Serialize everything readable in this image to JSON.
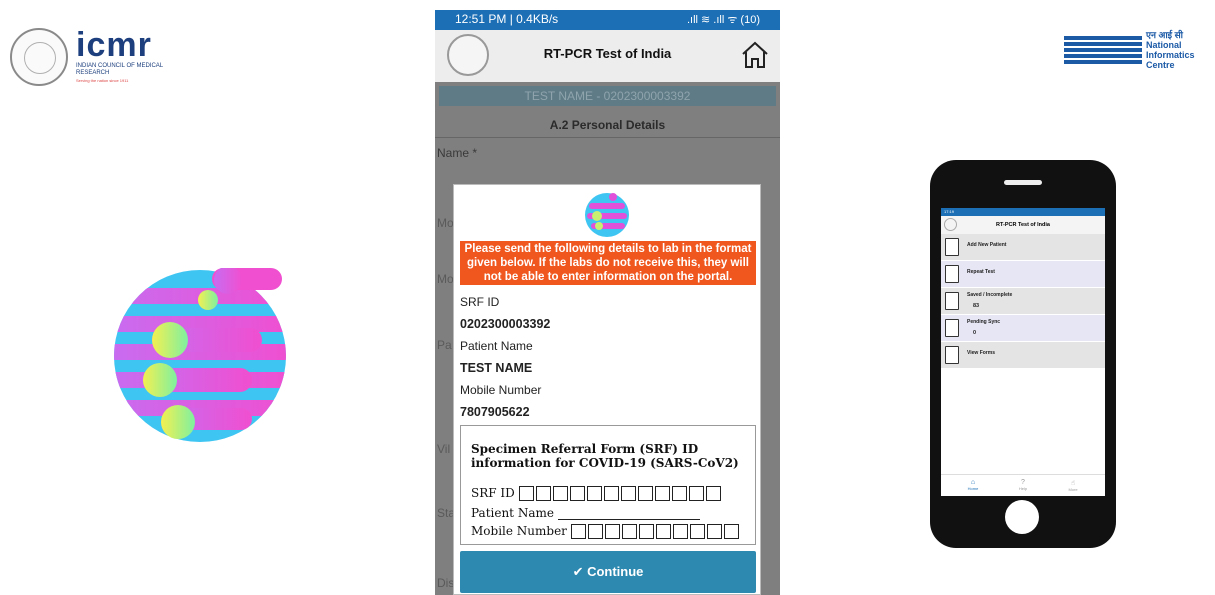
{
  "icmr": {
    "wordmark": "icmr",
    "subtitle": "INDIAN COUNCIL OF MEDICAL RESEARCH",
    "tagline": "Serving the nation since 1911"
  },
  "nic": {
    "hindi": "एन आई सी",
    "line1": "National",
    "line2": "Informatics",
    "line3": "Centre"
  },
  "phone": {
    "status_time": "12:51 PM | 0.4KB/s",
    "status_right": ".ıll ≋ .ıll ᯤ (10)",
    "app_title": "RT-PCR Test of India",
    "test_name_bar": "TEST NAME - 0202300003392",
    "section_title": "A.2 Personal Details",
    "bg_name_label": "Name *",
    "bg_ghost_1": "Mo",
    "bg_ghost_2": "Mo",
    "bg_ghost_3": "Pa",
    "bg_ghost_4": "Vil",
    "bg_ghost_5": "Sta",
    "bg_ghost_6": "Dis"
  },
  "modal": {
    "warning": "Please send the following details to lab in the format given below. If the labs do not receive this, they will not be able to enter information on the portal.",
    "srf_label": "SRF ID",
    "srf_value": "0202300003392",
    "patient_label": "Patient Name",
    "patient_value": "TEST NAME",
    "mobile_label": "Mobile Number",
    "mobile_value": "7807905622",
    "form_title": "Specimen Referral Form (SRF) ID information for COVID-19 (SARS-CoV2)",
    "form_srf": "SRF ID",
    "form_patient": "Patient Name",
    "form_mobile": "Mobile Number",
    "continue_label": "✔ Continue"
  },
  "mock": {
    "status": "17:19",
    "title": "RT-PCR Test of India",
    "items": [
      {
        "label": "Add New Patient",
        "count": ""
      },
      {
        "label": "Repeat Test",
        "count": ""
      },
      {
        "label": "Saved / Incomplete",
        "count": "83"
      },
      {
        "label": "Pending Sync",
        "count": "0"
      },
      {
        "label": "View Forms",
        "count": ""
      }
    ],
    "nav": [
      "Home",
      "Help",
      "More"
    ]
  },
  "colors": {
    "accent_blue": "#1c6fb5",
    "warning_orange": "#f0571e",
    "continue_teal": "#2e89b0"
  }
}
